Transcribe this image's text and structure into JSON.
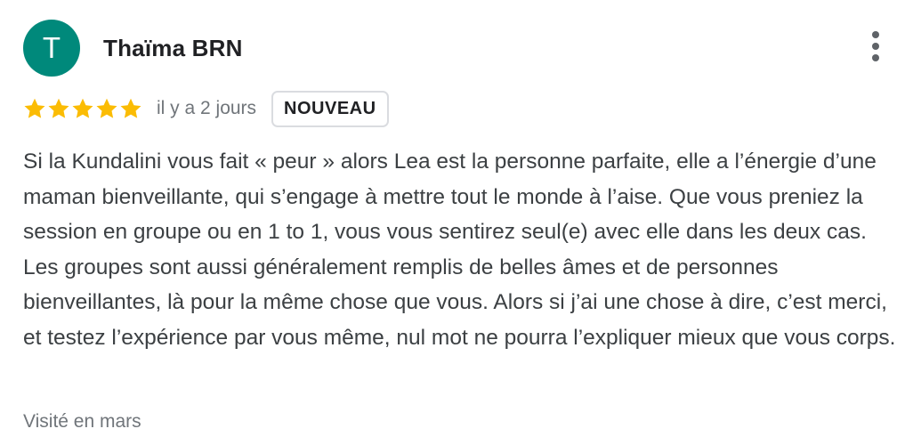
{
  "review": {
    "avatar_letter": "T",
    "avatar_color": "#00897b",
    "author": "Thaïma BRN",
    "rating": 5,
    "rating_max": 5,
    "star_color": "#fbbc04",
    "time_ago": "il y a 2 jours",
    "badge": "NOUVEAU",
    "text": "Si la Kundalini vous fait « peur » alors Lea est la personne parfaite, elle a l’énergie d’une maman bienveillante, qui s’engage à mettre tout le monde à l’aise. Que vous preniez la session en groupe ou en 1 to 1, vous vous sentirez seul(e) avec elle dans les deux cas. Les groupes sont aussi généralement remplis de belles âmes et de personnes bienveillantes, là pour la même chose que vous. Alors si j’ai une chose à dire, c’est merci, et testez l’expérience par vous même, nul mot ne pourra l’expliquer mieux que vous corps.",
    "visited": "Visité en mars",
    "more_icon": "more-vert-icon"
  }
}
